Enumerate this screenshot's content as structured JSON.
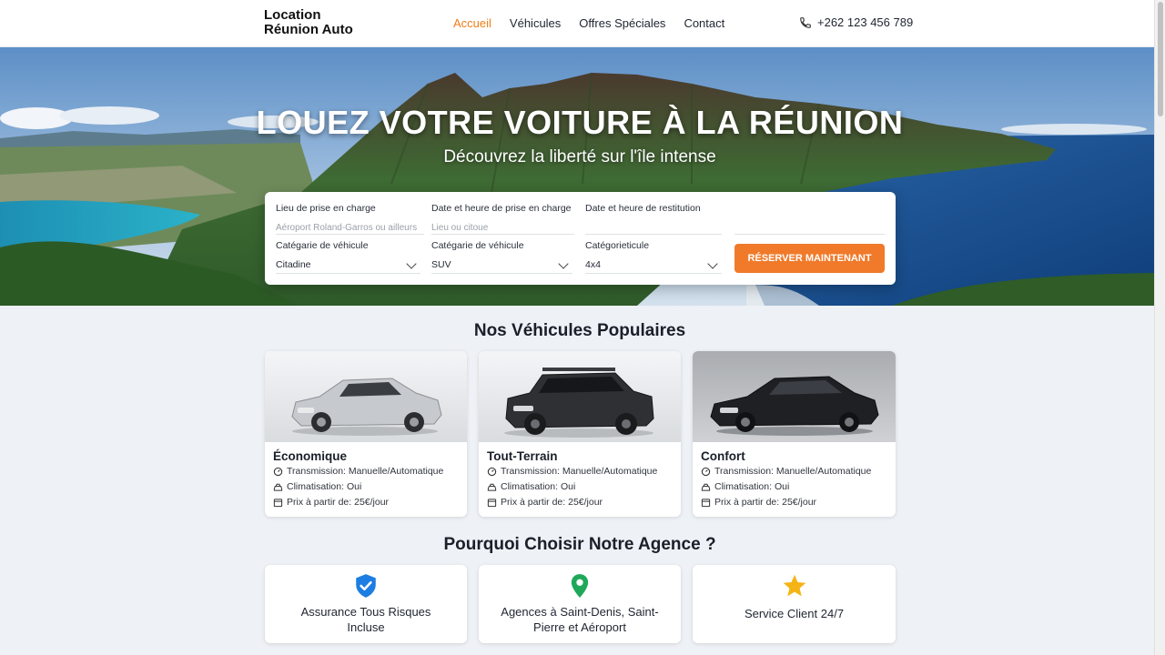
{
  "header": {
    "logo_line1": "Location",
    "logo_line2": "Réunion Auto",
    "nav": [
      "Accueil",
      "Véhicules",
      "Offres Spéciales",
      "Contact"
    ],
    "active_nav": "Accueil",
    "phone": "+262 123 456 789",
    "accent_color": "#ef7d1a"
  },
  "hero": {
    "title": "LOUEZ VOTRE VOITURE À LA RÉUNION",
    "subtitle": "Découvrez la liberté sur l'île intense"
  },
  "booking": {
    "pickup_label": "Lieu de prise en charge",
    "pickup_placeholder": "Aéroport Roland-Garros ou ailleurs",
    "pickup_datetime_label": "Date et heure de prise en charge",
    "pickup_datetime_placeholder": "Lieu ou citoue",
    "return_datetime_label": "Date et heure de restitution",
    "category1_label": "Catégarie de véhicule",
    "category1_value": "Citadine",
    "category2_label": "Catégarie de véhicule",
    "category2_value": "SUV",
    "category3_label": "Catégorieticule",
    "category3_value": "4x4",
    "reserve_button": "RÉSERVER MAINTENANT",
    "button_color": "#f07a2a"
  },
  "vehicles": {
    "title": "Nos Véhicules Populaires",
    "items": [
      {
        "name": "Économique",
        "transmission": "Transmission: Manuelle/Automatique",
        "ac": "Climatisation: Oui",
        "price": "Prix à partir de: 25€/jour",
        "car_color": "#c6c9cd"
      },
      {
        "name": "Tout-Terrain",
        "transmission": "Transmission: Manuelle/Automatique",
        "ac": "Climatisation: Oui",
        "price": "Prix à partir de: 25€/jour",
        "car_color": "#2e3033"
      },
      {
        "name": "Confort",
        "transmission": "Transmission: Manuelle/Automatique",
        "ac": "Climatisation: Oui",
        "price": "Prix à partir de: 25€/jour",
        "car_color": "#1e2024"
      }
    ]
  },
  "why": {
    "title": "Pourquoi Choisir Notre Agence ?",
    "items": [
      {
        "text": "Assurance Tous Risques Incluse",
        "icon": "shield-check-icon",
        "color": "#1d7de3"
      },
      {
        "text": "Agences à Saint-Denis, Saint-Pierre et Aéroport",
        "icon": "map-pin-icon",
        "color": "#1fa85a"
      },
      {
        "text": "Service Client 24/7",
        "icon": "star-icon",
        "color": "#f5b416"
      }
    ]
  }
}
